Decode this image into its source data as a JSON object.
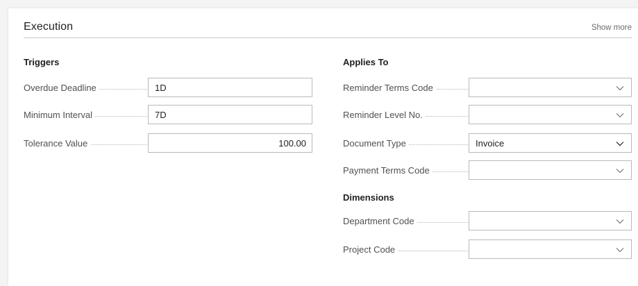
{
  "section": {
    "title": "Execution",
    "show_more": "Show more"
  },
  "triggers": {
    "title": "Triggers",
    "fields": [
      {
        "label": "Overdue Deadline",
        "value": "1D"
      },
      {
        "label": "Minimum Interval",
        "value": "7D"
      },
      {
        "label": "Tolerance Value",
        "value": "100.00"
      }
    ]
  },
  "applies_to": {
    "title": "Applies To",
    "fields": [
      {
        "label": "Reminder Terms Code",
        "value": ""
      },
      {
        "label": "Reminder Level No.",
        "value": ""
      },
      {
        "label": "Document Type",
        "value": "Invoice"
      },
      {
        "label": "Payment Terms Code",
        "value": ""
      }
    ]
  },
  "dimensions": {
    "title": "Dimensions",
    "fields": [
      {
        "label": "Department Code",
        "value": ""
      },
      {
        "label": "Project Code",
        "value": ""
      }
    ]
  },
  "icons": {
    "dropdown": "chevron-down-icon"
  }
}
